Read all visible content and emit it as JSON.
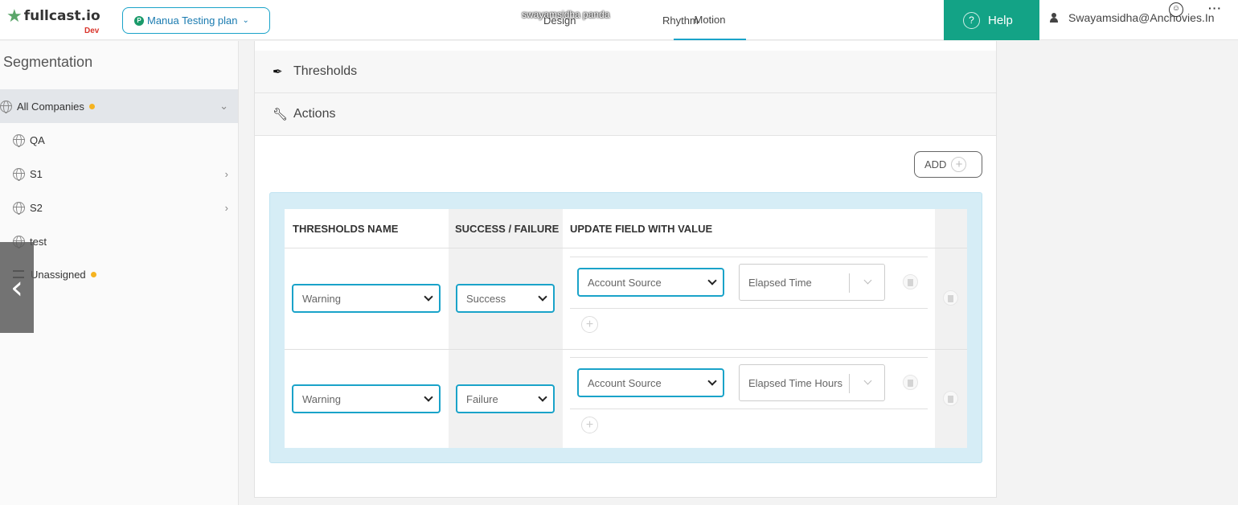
{
  "header": {
    "brand": "fullcast.io",
    "env": "Dev",
    "plan_badge": "P",
    "plan_label": "Manua Testing plan",
    "presenter": "swayamsidha panda",
    "tabs": [
      {
        "label": "Design"
      },
      {
        "label": "Rhythm"
      },
      {
        "label": "Motion"
      }
    ],
    "active_tab": "Motion",
    "help_label": "Help",
    "user_email": "Swayamsidha@Anchovies.In",
    "accent_color": "#1aa3c9",
    "help_color": "#13a386"
  },
  "sidebar": {
    "title": "Segmentation",
    "items": [
      {
        "label": "All Companies",
        "dot": true,
        "chevron": "down"
      },
      {
        "label": "QA"
      },
      {
        "label": "S1",
        "chevron": "right"
      },
      {
        "label": "S2",
        "chevron": "right"
      },
      {
        "label": "test"
      },
      {
        "label": "Unassigned",
        "dot": true
      }
    ]
  },
  "main": {
    "sections": {
      "thresholds": "Thresholds",
      "actions": "Actions"
    },
    "add_label": "ADD",
    "table": {
      "columns": [
        "THRESHOLDS NAME",
        "SUCCESS / FAILURE",
        "UPDATE FIELD WITH VALUE"
      ],
      "rows": [
        {
          "threshold": "Warning",
          "status": "Success",
          "field": "Account Source",
          "value": "Elapsed Time"
        },
        {
          "threshold": "Warning",
          "status": "Failure",
          "field": "Account Source",
          "value": "Elapsed Time Hours"
        }
      ]
    }
  }
}
